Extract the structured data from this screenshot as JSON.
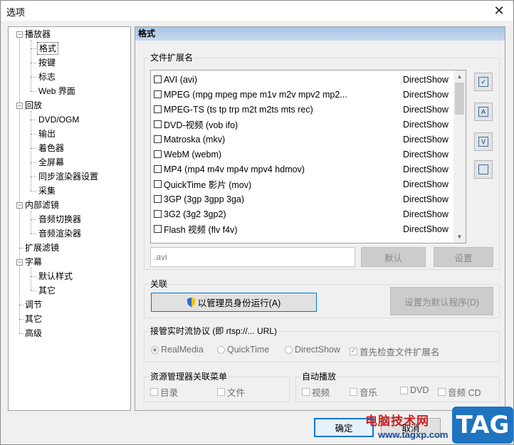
{
  "window": {
    "title": "选项",
    "close_glyph": "✕"
  },
  "tree": {
    "player": "播放器",
    "player_children": [
      "格式",
      "按键",
      "标志",
      "Web 界面"
    ],
    "playback": "回放",
    "playback_children": [
      "DVD/OGM",
      "输出",
      "着色器",
      "全屏幕",
      "同步渲染器设置",
      "采集"
    ],
    "internal_filters": "内部滤镜",
    "internal_children": [
      "音频切换器",
      "音频渲染器"
    ],
    "external_filters": "扩展滤镜",
    "subtitles": "字幕",
    "subtitle_children": [
      "默认样式",
      "其它"
    ],
    "tweaks": "调节",
    "misc": "其它",
    "advanced": "高级"
  },
  "panel": {
    "header": "格式"
  },
  "extensions": {
    "group_label": "文件扩展名",
    "rows": [
      {
        "name": "AVI (avi)",
        "engine": "DirectShow"
      },
      {
        "name": "MPEG (mpg mpeg mpe m1v m2v mpv2 mp2...",
        "engine": "DirectShow"
      },
      {
        "name": "MPEG-TS (ts tp trp m2t m2ts mts rec)",
        "engine": "DirectShow"
      },
      {
        "name": "DVD-视频 (vob ifo)",
        "engine": "DirectShow"
      },
      {
        "name": "Matroska (mkv)",
        "engine": "DirectShow"
      },
      {
        "name": "WebM (webm)",
        "engine": "DirectShow"
      },
      {
        "name": "MP4 (mp4 m4v mp4v mpv4 hdmov)",
        "engine": "DirectShow"
      },
      {
        "name": "QuickTime 影片 (mov)",
        "engine": "DirectShow"
      },
      {
        "name": "3GP (3gp 3gpp 3ga)",
        "engine": "DirectShow"
      },
      {
        "name": "3G2 (3g2 3gp2)",
        "engine": "DirectShow"
      },
      {
        "name": "Flash 视频 (flv f4v)",
        "engine": "DirectShow"
      }
    ],
    "input_value": ".avi",
    "default_button": "默认",
    "set_button": "设置",
    "side_icons": [
      "check-all-icon",
      "audio-files-icon",
      "video-files-icon",
      "copy-icon"
    ],
    "side_glyphs": [
      "✓",
      "A",
      "V",
      ""
    ]
  },
  "association": {
    "group_label": "关联",
    "run_as_admin": "以管理员身份运行(A)",
    "set_default": "设置为默认程序(D)"
  },
  "rtsp": {
    "group_label": "接管实时流协议 (即 rtsp://... URL)",
    "options": [
      "RealMedia",
      "QuickTime",
      "DirectShow"
    ],
    "check_ext": "首先检查文件扩展名"
  },
  "explorer": {
    "group_label": "资源管理器关联菜单",
    "directory": "目录",
    "file": "文件"
  },
  "autoplay": {
    "group_label": "自动播放",
    "video": "视频",
    "music": "音乐",
    "dvd": "DVD",
    "audio_cd": "音频 CD"
  },
  "footer": {
    "ok": "确定",
    "cancel": "取消"
  },
  "watermark": {
    "text": "电脑技术网",
    "url": "www.tagxp.com",
    "tag": "TAG"
  }
}
